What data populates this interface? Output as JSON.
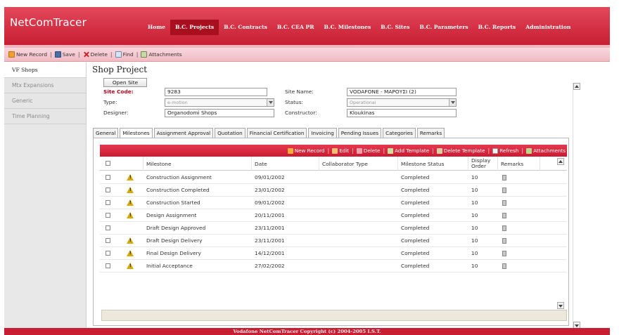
{
  "app": {
    "title": "NetComTracer",
    "nav": [
      {
        "label": "Home",
        "active": false
      },
      {
        "label": "B.C. Projects",
        "active": true
      },
      {
        "label": "B.C. Contracts",
        "active": false
      },
      {
        "label": "B.C. CEA PR",
        "active": false
      },
      {
        "label": "B.C. Milestones",
        "active": false
      },
      {
        "label": "B.C. Sites",
        "active": false
      },
      {
        "label": "B.C. Parameters",
        "active": false
      },
      {
        "label": "B.C. Reports",
        "active": false
      },
      {
        "label": "Administration",
        "active": false
      }
    ],
    "accent_color": "#c81e33"
  },
  "toolbar": {
    "new_record": "New Record",
    "save": "Save",
    "delete": "Delete",
    "find": "Find",
    "attachments": "Attachments",
    "separator": "|"
  },
  "sidebar": {
    "items": [
      {
        "label": "VF Shops",
        "active": true
      },
      {
        "label": "Mtx Expansions",
        "active": false
      },
      {
        "label": "Generic",
        "active": false
      },
      {
        "label": "Time Planning",
        "active": false
      }
    ]
  },
  "form": {
    "page_title": "Shop Project",
    "open_site_label": "Open Site",
    "site_code_label": "Site Code:",
    "site_code_value": "9283",
    "site_name_label": "Site Name:",
    "site_name_value": "VODAFONE - ΜΑΡΟΥΣΙ (2)",
    "type_label": "Type:",
    "type_value": "e-motion",
    "status_label": "Status:",
    "status_value": "Operational",
    "designer_label": "Designer:",
    "designer_value": "Organodomi Shops",
    "constructor_label": "Constructor:",
    "constructor_value": "Kloukinas"
  },
  "tabs": [
    {
      "label": "General",
      "active": false
    },
    {
      "label": "Milestones",
      "active": true
    },
    {
      "label": "Assignment Approval",
      "active": false
    },
    {
      "label": "Quotation",
      "active": false
    },
    {
      "label": "Financial Certification",
      "active": false
    },
    {
      "label": "Invoicing",
      "active": false
    },
    {
      "label": "Pending Issues",
      "active": false
    },
    {
      "label": "Categories",
      "active": false
    },
    {
      "label": "Remarks",
      "active": false
    }
  ],
  "grid_toolbar": {
    "new_record": "New Record",
    "edit": "Edit",
    "delete": "Delete",
    "add_template": "Add Template",
    "delete_template": "Delete Template",
    "refresh": "Refresh",
    "attachments": "Attachments",
    "separator": "|"
  },
  "milestones": {
    "columns": [
      "Milestone",
      "Date",
      "Collaborator Type",
      "Milestone Status",
      "Display Order",
      "Remarks"
    ],
    "rows": [
      {
        "milestone": "Construction Assignment",
        "date": "09/01/2002",
        "collaborator_type": "",
        "status": "Completed",
        "order": "10",
        "warning": true
      },
      {
        "milestone": "Construction Completed",
        "date": "23/01/2002",
        "collaborator_type": "",
        "status": "Completed",
        "order": "10",
        "warning": true
      },
      {
        "milestone": "Construction Started",
        "date": "09/01/2002",
        "collaborator_type": "",
        "status": "Completed",
        "order": "10",
        "warning": true
      },
      {
        "milestone": "Design Assignment",
        "date": "20/11/2001",
        "collaborator_type": "",
        "status": "Completed",
        "order": "10",
        "warning": true
      },
      {
        "milestone": "Draft Design Approved",
        "date": "23/11/2001",
        "collaborator_type": "",
        "status": "Completed",
        "order": "10",
        "warning": false
      },
      {
        "milestone": "Draft Design Delivery",
        "date": "23/11/2001",
        "collaborator_type": "",
        "status": "Completed",
        "order": "10",
        "warning": true
      },
      {
        "milestone": "Final Design Delivery",
        "date": "14/12/2001",
        "collaborator_type": "",
        "status": "Completed",
        "order": "10",
        "warning": true
      },
      {
        "milestone": "Initial Acceptance",
        "date": "27/02/2002",
        "collaborator_type": "",
        "status": "Completed",
        "order": "10",
        "warning": true
      }
    ]
  },
  "footer": {
    "copyright": "Vodafone NetComTracer Copyright (c) 2004-2005 I.S.T."
  }
}
